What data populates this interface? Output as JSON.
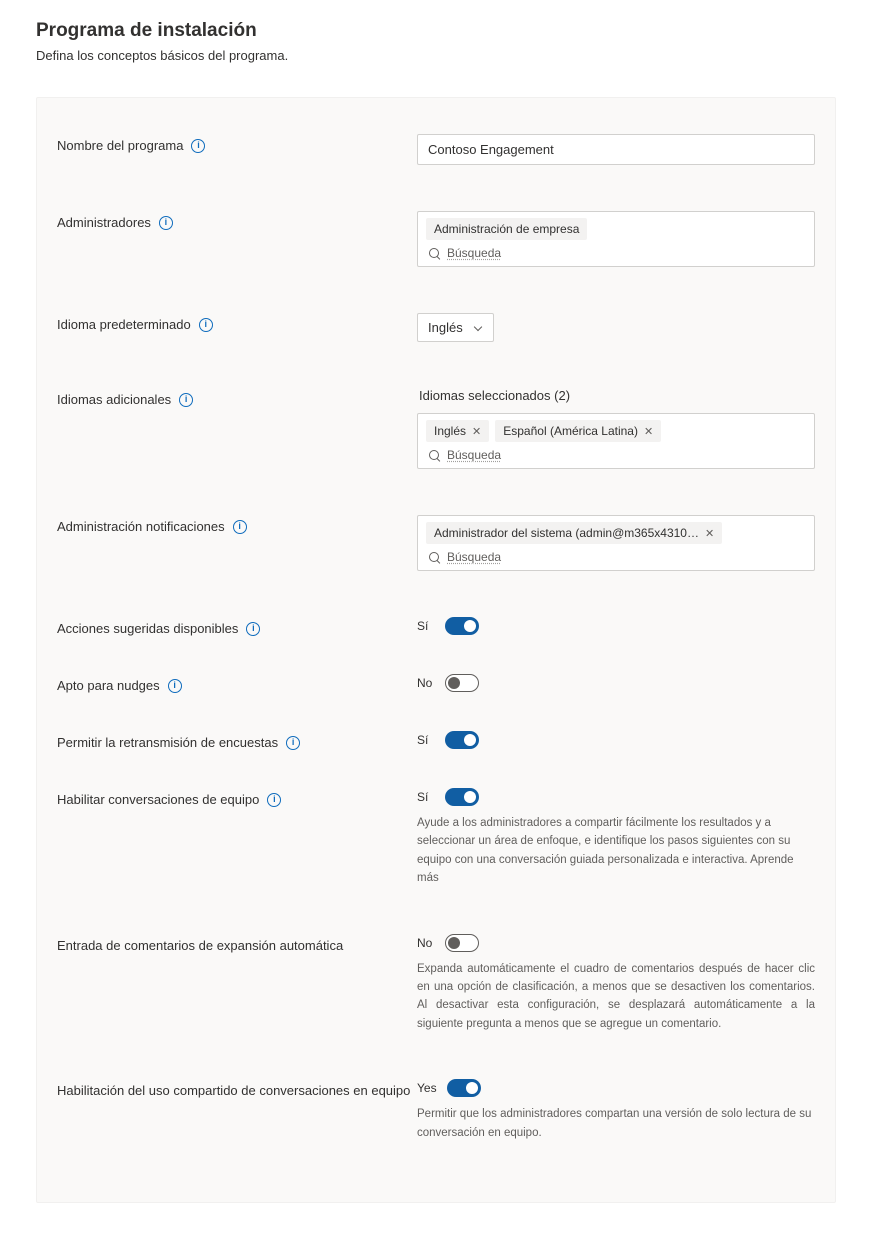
{
  "header": {
    "title": "Programa de instalación",
    "subtitle": "Defina los conceptos básicos del programa."
  },
  "labels": {
    "program_name": "Nombre del programa",
    "admins": "Administradores",
    "default_lang": "Idioma predeterminado",
    "additional_langs": "Idiomas adicionales",
    "admin_notifications": "Administración notificaciones",
    "suggested_actions": "Acciones sugeridas disponibles",
    "nudges": "Apto para nudges",
    "survey_rebroadcast": "Permitir la retransmisión de encuestas",
    "team_conv": "Habilitar conversaciones de equipo",
    "auto_expand_comments": "Entrada de comentarios de expansión automática",
    "team_share": "Habilitación del uso compartido de conversaciones en equipo"
  },
  "values": {
    "program_name": "Contoso Engagement",
    "admin_chip": "Administración de empresa",
    "search_placeholder": "Búsqueda",
    "default_lang_selected": "Inglés",
    "selected_langs_header": "Idiomas seleccionados (2)",
    "lang_chip_1": "Inglés",
    "lang_chip_2": "Español (América Latina)",
    "notif_chip": "Administrador del sistema (admin@m365x4310…"
  },
  "toggles": {
    "suggested_actions": {
      "state": "Sí",
      "on": true
    },
    "nudges": {
      "state": "No",
      "on": false
    },
    "survey_rebroadcast": {
      "state": "Sí",
      "on": true
    },
    "team_conv": {
      "state": "Sí",
      "on": true
    },
    "auto_expand_comments": {
      "state": "No",
      "on": false
    },
    "team_share": {
      "state": "Yes",
      "on": true
    }
  },
  "help": {
    "team_conv": "Ayude a los administradores a compartir fácilmente los resultados y a seleccionar un área de enfoque, e identifique los pasos siguientes con su equipo con una conversación guiada personalizada e interactiva. Aprende más",
    "auto_expand": "Expanda automáticamente el cuadro de comentarios después de hacer clic en una opción de clasificación, a menos que se desactiven los comentarios. Al desactivar esta configuración, se desplazará automáticamente a la siguiente pregunta a menos que se agregue un comentario.",
    "team_share": "Permitir que los administradores compartan una versión de solo lectura de su conversación en equipo."
  }
}
